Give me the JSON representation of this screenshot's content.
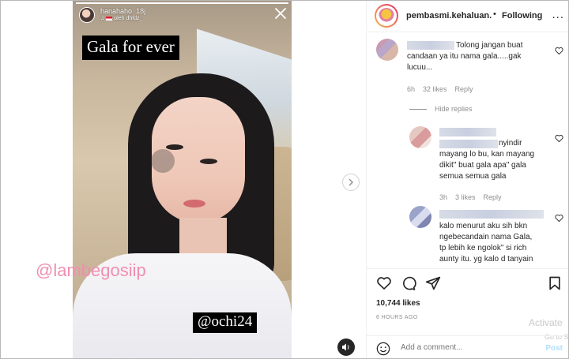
{
  "story": {
    "username": "hanahaho",
    "time": "18j",
    "sub": "oleh dhfdz_",
    "caption": "Gala for ever",
    "watermark": "@lambegosiip",
    "handle": "@ochi24",
    "progress": 1
  },
  "post_header": {
    "username": "pembasmi.kehaluan.re",
    "dot": "•",
    "follow_label": "Following",
    "more": "..."
  },
  "comments": [
    {
      "text_lines": [
        "Tolong jangan buat",
        "candaan ya itu nama gala.....gak",
        "lucuu..."
      ],
      "time": "6h",
      "likes": "32 likes",
      "reply": "Reply"
    },
    {
      "hide_replies": "Hide replies"
    },
    {
      "text_lines": [
        "nyindir",
        "mayang lo bu, kan mayang",
        "dikit\" buat gala apa\" gala",
        "semua semua gala"
      ],
      "time": "3h",
      "likes": "3 likes",
      "reply": "Reply"
    },
    {
      "text_lines": [
        "kalo menurut aku sih bkn",
        "ngebecandain nama Gala,",
        "tp lebih ke ngolok\" si rich",
        "aunty itu. yg kalo d tanyain"
      ]
    }
  ],
  "likes_count": "10,744 likes",
  "time_ago": "6 HOURS AGO",
  "windows_watermark": {
    "line1": "Activate",
    "line2": "Go to Sett"
  },
  "add_comment": {
    "placeholder": "Add a comment...",
    "post_label": "Post"
  },
  "colors": {
    "watermark": "#f08fb0",
    "post_disabled": "#b2dffc"
  }
}
